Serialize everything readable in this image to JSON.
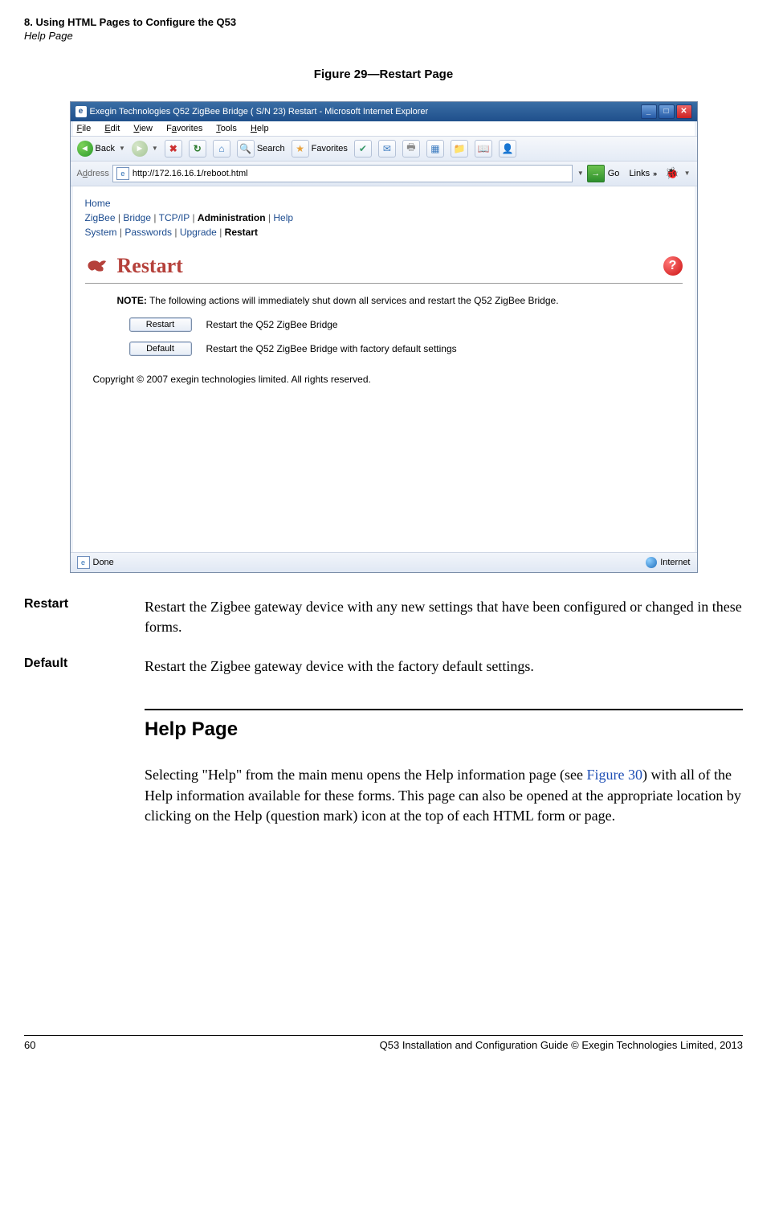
{
  "header": {
    "chapter": "8. Using HTML Pages to Configure the Q53",
    "section": "Help Page"
  },
  "figure_caption": "Figure 29—Restart Page",
  "ie": {
    "title": "Exegin Technologies Q52 ZigBee Bridge ( S/N 23) Restart - Microsoft Internet Explorer",
    "menu": {
      "file": "File",
      "edit": "Edit",
      "view": "View",
      "fav": "Favorites",
      "tools": "Tools",
      "help": "Help"
    },
    "back": "Back",
    "search": "Search",
    "favorites": "Favorites",
    "addr_label": "Address",
    "url": "http://172.16.16.1/reboot.html",
    "go": "Go",
    "links": "Links",
    "status_done": "Done",
    "status_zone": "Internet"
  },
  "crumbs": {
    "home": "Home",
    "l1": [
      "ZigBee",
      "Bridge",
      "TCP/IP",
      "Administration",
      "Help"
    ],
    "l1_bold": "Administration",
    "l2": [
      "System",
      "Passwords",
      "Upgrade",
      "Restart"
    ],
    "l2_bold": "Restart"
  },
  "page": {
    "heading": "Restart",
    "note_label": "NOTE:",
    "note_text": " The following actions will immediately shut down all services and restart the Q52 ZigBee Bridge.",
    "btn_restart": "Restart",
    "restart_desc": "Restart the Q52 ZigBee Bridge",
    "btn_default": "Default",
    "default_desc": "Restart the Q52 ZigBee Bridge with factory default settings",
    "copyright": "Copyright © 2007 exegin technologies limited. All rights reserved."
  },
  "definitions": {
    "restart_term": "Restart",
    "restart_desc": "Restart the Zigbee gateway device with any new settings that have been configured or changed in these forms.",
    "default_term": "Default",
    "default_desc": "Restart the Zigbee gateway device with the factory default settings."
  },
  "help_section": {
    "heading": "Help Page",
    "body_pre": "Selecting \"Help\" from the main menu opens the Help information page (see ",
    "figref": "Figure 30",
    "body_post": ") with all of the Help information available for these forms. This page can also be opened at the appropriate location by clicking on the Help (question mark) icon at the top of each HTML form or page."
  },
  "footer": {
    "page": "60",
    "text": "Q53 Installation and Configuration Guide  © Exegin Technologies Limited, 2013"
  }
}
